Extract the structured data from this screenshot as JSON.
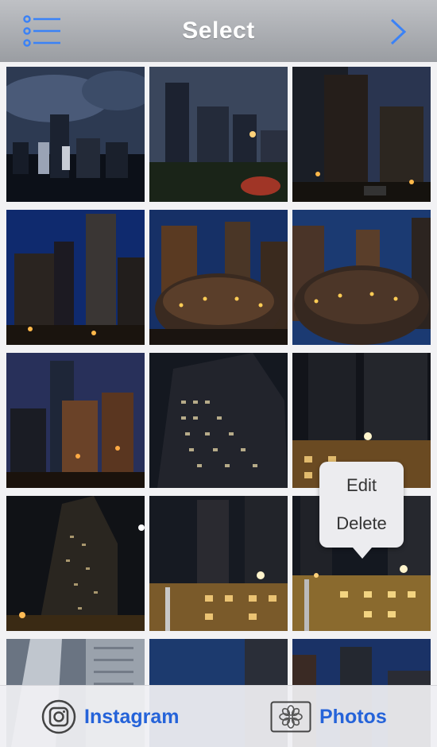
{
  "header": {
    "title": "Select"
  },
  "colors": {
    "accent": "#2563d9",
    "header_top": "#bfc1c5",
    "header_bottom": "#9a9da2"
  },
  "context_menu": {
    "items": [
      "Edit",
      "Delete"
    ]
  },
  "toolbar": {
    "instagram_label": "Instagram",
    "photos_label": "Photos"
  },
  "icons": {
    "list": "list-icon",
    "next": "chevron-right-icon",
    "instagram": "instagram-icon",
    "photos": "photos-flower-icon"
  },
  "thumbnails": [
    "skyline-cloudy-dusk",
    "skyline-street-trails",
    "skyscrapers-night",
    "towers-blue-hour",
    "cloud-gate-bean",
    "cloud-gate-reflection",
    "art-deco-tower",
    "office-tower-windows",
    "historic-building-corner",
    "lit-tower-closeup",
    "street-corner-tower",
    "street-corner-lamps",
    "glass-tower-partial",
    "tower-roof-partial",
    "building-dark-partial"
  ]
}
